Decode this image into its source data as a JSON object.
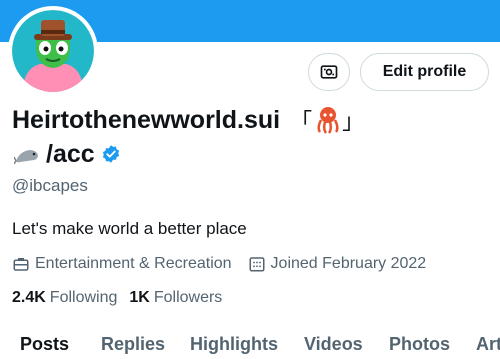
{
  "colors": {
    "banner": "#1d9bf0",
    "verified_badge": "#1d9bf0",
    "text_primary": "#0f1419",
    "text_secondary": "#536471",
    "border": "#cfd9de"
  },
  "profile": {
    "avatar_icon": "green-cartoon-character-avatar",
    "name_line1": "Heirtothenewworld.sui",
    "bracket_open": "「",
    "bracket_close": "」",
    "name_emoji": "squid-emoji",
    "name_line2": "/acc",
    "name_line2_emoji": "seal-emoji",
    "verified_icon": "verified-badge-icon",
    "handle": "@ibcapes",
    "bio": "Let's make world a better place",
    "category_icon": "briefcase-icon",
    "category": "Entertainment & Recreation",
    "joined_icon": "calendar-icon",
    "joined": "Joined February 2022"
  },
  "actions": {
    "wallet_icon": "wallet-icon",
    "edit_label": "Edit profile"
  },
  "stats": {
    "following_count": "2.4K",
    "following_label": "Following",
    "followers_count": "1K",
    "followers_label": "Followers"
  },
  "tabs": [
    {
      "label": "Posts",
      "active": true
    },
    {
      "label": "Replies",
      "active": false
    },
    {
      "label": "Highlights",
      "active": false
    },
    {
      "label": "Videos",
      "active": false
    },
    {
      "label": "Photos",
      "active": false
    },
    {
      "label": "Art",
      "active": false
    }
  ]
}
